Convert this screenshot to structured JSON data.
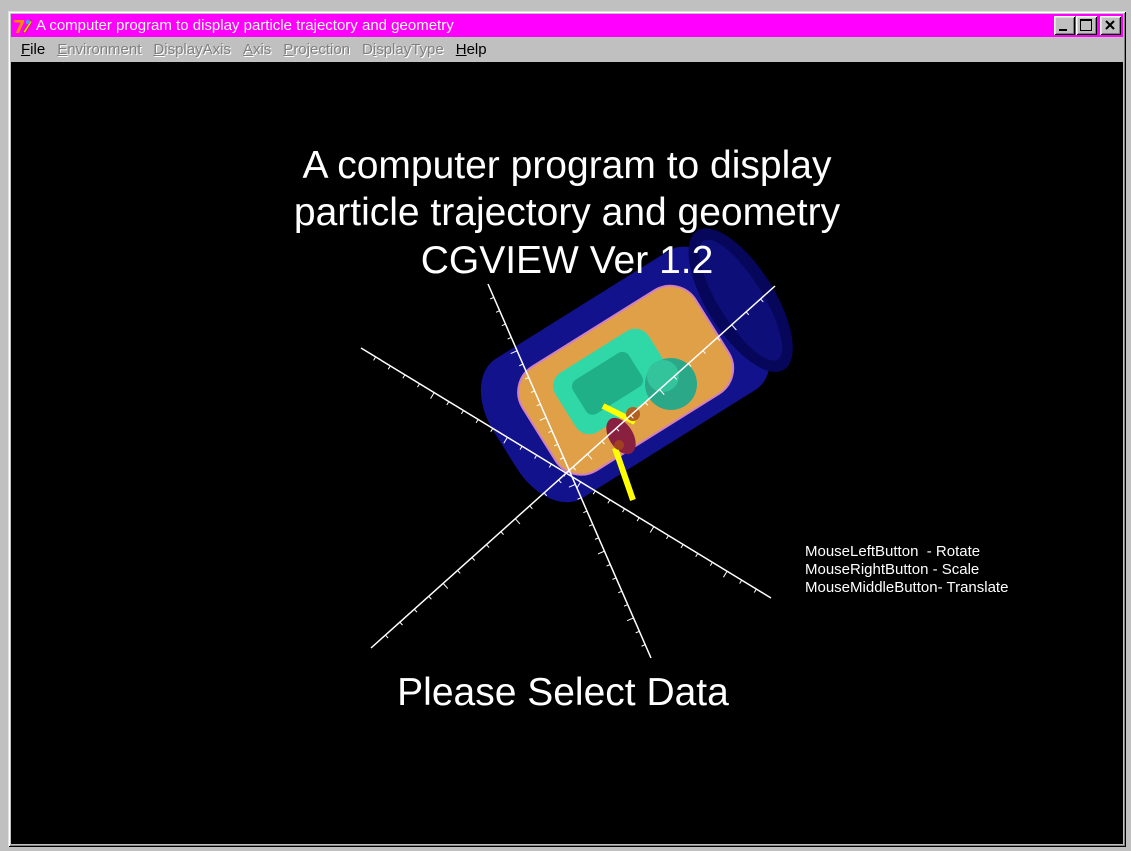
{
  "window": {
    "title": "A computer program to display particle trajectory and geometry",
    "title_bar_color": "#ff00ff"
  },
  "menu": [
    {
      "prefix": "",
      "accel": "F",
      "rest": "ile",
      "enabled": true
    },
    {
      "prefix": "",
      "accel": "E",
      "rest": "nvironment",
      "enabled": false
    },
    {
      "prefix": "",
      "accel": "D",
      "rest": "isplayAxis",
      "enabled": false
    },
    {
      "prefix": "",
      "accel": "A",
      "rest": "xis",
      "enabled": false
    },
    {
      "prefix": "",
      "accel": "P",
      "rest": "rojection",
      "enabled": false
    },
    {
      "prefix": "D",
      "accel": "i",
      "rest": "splayType",
      "enabled": false
    },
    {
      "prefix": "",
      "accel": "H",
      "rest": "elp",
      "enabled": true
    }
  ],
  "canvas": {
    "heading_lines": [
      "A computer program to display",
      "particle trajectory and geometry",
      "CGVIEW Ver 1.2"
    ],
    "prompt": "Please Select Data",
    "mouse_help": [
      "MouseLeftButton  - Rotate",
      "MouseRightButton - Scale",
      "MouseMiddleButton- Translate"
    ],
    "colors": {
      "outer_cylinder": "#12128c",
      "outer_cylinder_rim": "#000066",
      "middle_layer": "#e0a048",
      "middle_layer_edge": "#d080c0",
      "inner_layer": "#30d8a8",
      "sphere": "#30b890",
      "core": "#8a2040",
      "rod": "#ffff00",
      "axes": "#ffffff"
    }
  }
}
